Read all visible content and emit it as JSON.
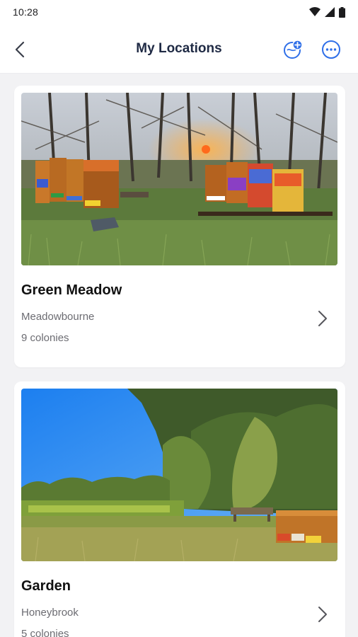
{
  "status_bar": {
    "time": "10:28",
    "icons": [
      "wifi-icon",
      "signal-icon",
      "battery-icon"
    ]
  },
  "app_bar": {
    "title": "My Locations",
    "back_icon": "chevron-left-icon",
    "actions": [
      "add-location-icon",
      "more-options-icon"
    ]
  },
  "colors": {
    "accent": "#2f6fe8",
    "background": "#f2f2f4",
    "card": "#ffffff",
    "secondary_text": "#6c6c72"
  },
  "locations": [
    {
      "name": "Green Meadow",
      "place": "Meadowbourne",
      "colonies": "9 colonies",
      "photo": "beehives in meadow at sunset"
    },
    {
      "name": "Garden",
      "place": "Honeybrook",
      "colonies": "5 colonies",
      "photo": "garden with beehives under blue sky"
    }
  ]
}
